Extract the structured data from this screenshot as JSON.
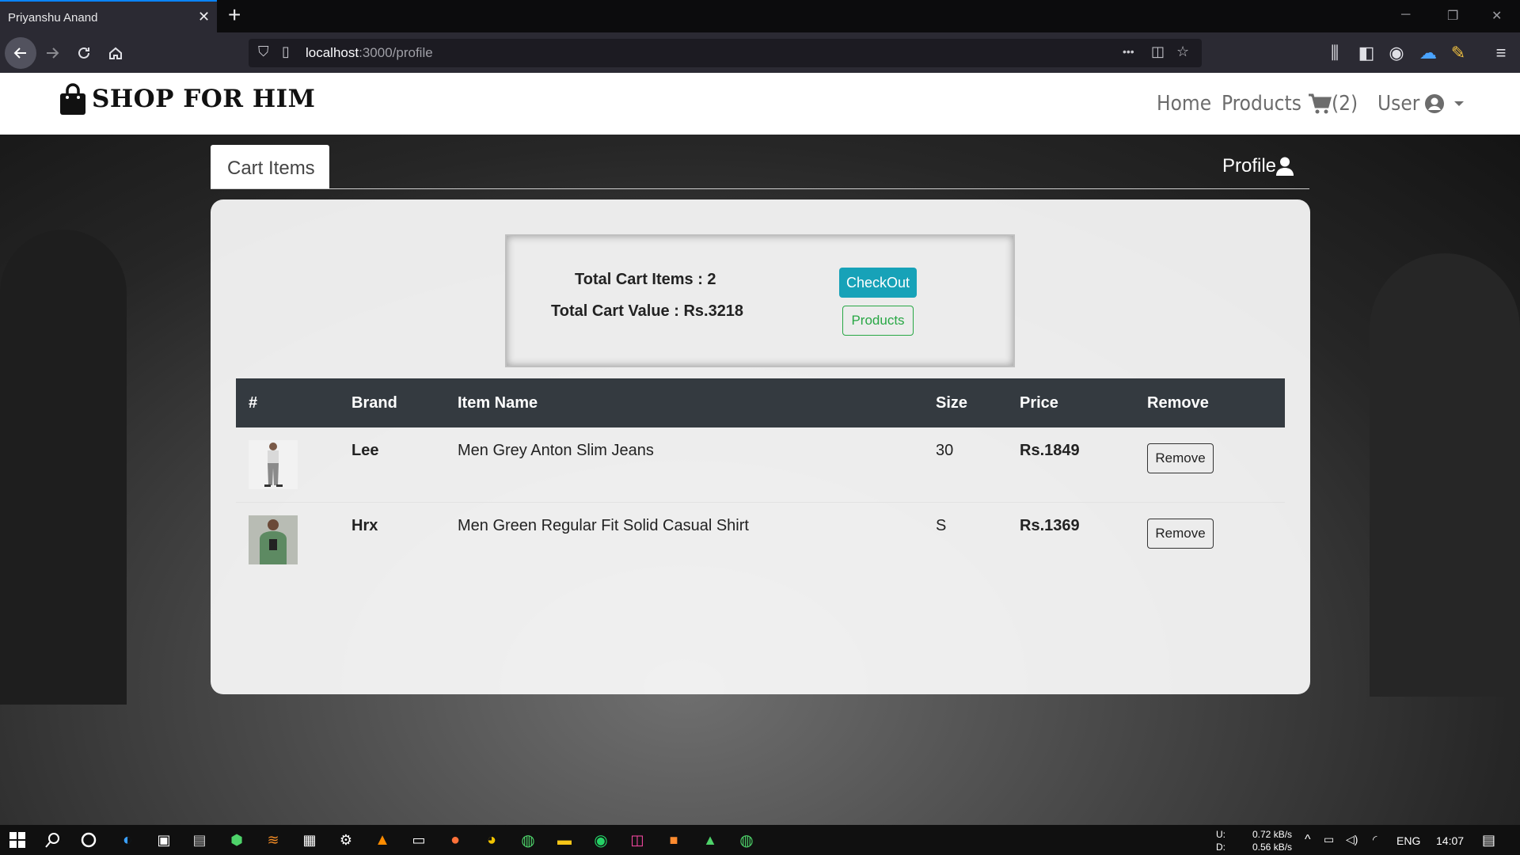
{
  "browser": {
    "tab_title": "Priyanshu Anand",
    "tab_close": "✕",
    "new_tab": "+",
    "url_host": "localhost",
    "url_path": ":3000/profile",
    "more_icon": "•••"
  },
  "site": {
    "brand": "SHOP FOR HIM",
    "nav": {
      "home": "Home",
      "products": "Products",
      "cart_count": "(2)",
      "user": "User"
    }
  },
  "tabs": {
    "cart": "Cart Items",
    "profile": "Profile"
  },
  "summary": {
    "total_items": "Total Cart Items : 2",
    "total_value": "Total Cart Value : Rs.3218",
    "checkout": "CheckOut",
    "products": "Products"
  },
  "table": {
    "headers": [
      "#",
      "Brand",
      "Item Name",
      "Size",
      "Price",
      "Remove"
    ],
    "rows": [
      {
        "brand": "Lee",
        "item": "Men Grey Anton Slim Jeans",
        "size": "30",
        "price": "Rs.1849",
        "remove": "Remove"
      },
      {
        "brand": "Hrx",
        "item": "Men Green Regular Fit Solid Casual Shirt",
        "size": "S",
        "price": "Rs.1369",
        "remove": "Remove"
      }
    ]
  },
  "taskbar": {
    "upload_label": "U:",
    "download_label": "D:",
    "upload_speed": "0.72 kB/s",
    "download_speed": "0.56 kB/s",
    "language": "ENG",
    "time": "14:07"
  },
  "colors": {
    "checkout": "#17a2b8",
    "products_outline": "#28a745",
    "table_header": "#343a40",
    "tab_accent": "#0a84ff"
  }
}
